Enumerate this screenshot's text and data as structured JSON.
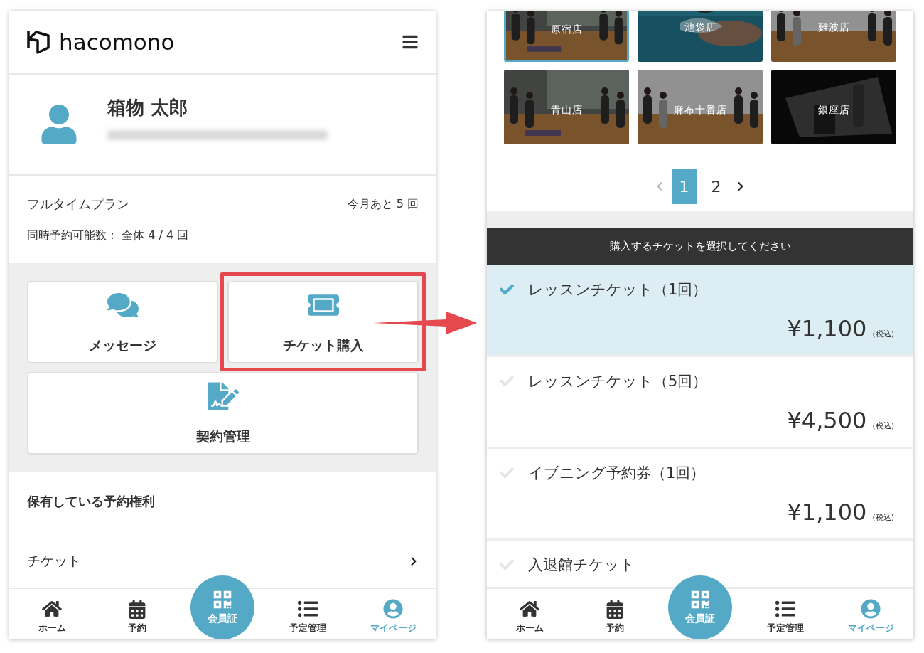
{
  "left": {
    "header": {
      "logo": "hacomono"
    },
    "profile": {
      "name": "箱物 太郎"
    },
    "plan": {
      "name": "フルタイムプラン",
      "remaining": "今月あと 5 回",
      "concurrent": "同時予約可能数： 全体 4 / 4 回"
    },
    "actions": [
      {
        "label": "メッセージ",
        "kind": "message",
        "highlighted": false
      },
      {
        "label": "チケット購入",
        "kind": "ticket",
        "highlighted": true
      },
      {
        "label": "契約管理",
        "kind": "contract",
        "highlighted": false
      }
    ],
    "rights": {
      "title": "保有している予約権利",
      "rows": [
        {
          "label": "チケット"
        }
      ]
    },
    "nav": [
      {
        "label": "ホーム",
        "kind": "home",
        "selected": false
      },
      {
        "label": "予約",
        "kind": "calendar",
        "selected": false
      },
      {
        "label": "会員証",
        "kind": "center"
      },
      {
        "label": "予定管理",
        "kind": "list",
        "selected": false
      },
      {
        "label": "マイページ",
        "kind": "user",
        "selected": true
      }
    ]
  },
  "right": {
    "stores": [
      {
        "name": "原宿店",
        "selected": true
      },
      {
        "name": "池袋店",
        "selected": false
      },
      {
        "name": "難波店",
        "selected": false
      },
      {
        "name": "青山店",
        "selected": false
      },
      {
        "name": "麻布十番店",
        "selected": false
      },
      {
        "name": "銀座店",
        "selected": false
      }
    ],
    "pagination": {
      "pages": [
        {
          "label": "1",
          "selected": true
        },
        {
          "label": "2",
          "selected": false
        }
      ]
    },
    "tickets": {
      "title": "購入するチケットを選択してください",
      "items": [
        {
          "name": "レッスンチケット（1回）",
          "price": "¥1,100",
          "tax": "(税込)",
          "selected": true
        },
        {
          "name": "レッスンチケット（5回）",
          "price": "¥4,500",
          "tax": "(税込)",
          "selected": false
        },
        {
          "name": "イブニング予約券（1回）",
          "price": "¥1,100",
          "tax": "(税込)",
          "selected": false
        },
        {
          "name": "入退館チケット",
          "selected": false
        }
      ]
    },
    "nav": [
      {
        "label": "ホーム",
        "kind": "home",
        "selected": false
      },
      {
        "label": "予約",
        "kind": "calendar",
        "selected": false
      },
      {
        "label": "会員証",
        "kind": "center"
      },
      {
        "label": "予定管理",
        "kind": "list",
        "selected": false
      },
      {
        "label": "マイページ",
        "kind": "user",
        "selected": true
      }
    ]
  }
}
